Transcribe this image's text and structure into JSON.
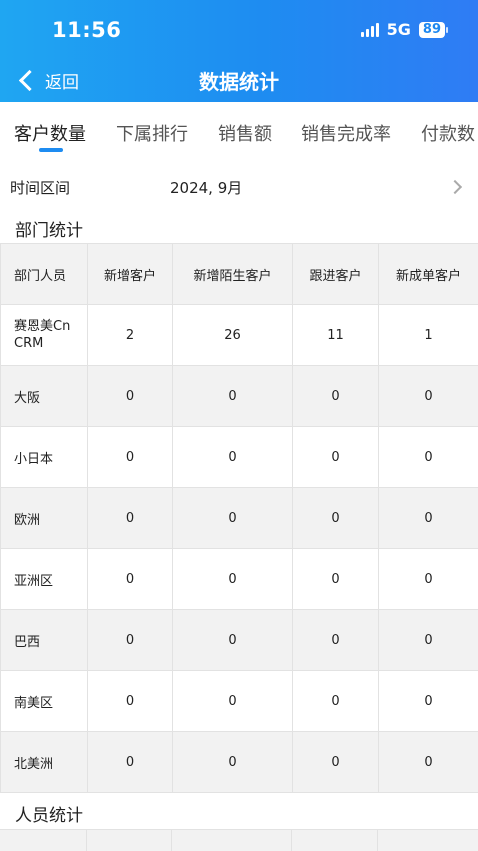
{
  "status": {
    "time": "11:56",
    "network": "5G",
    "battery": "89"
  },
  "nav": {
    "back_label": "返回",
    "title": "数据统计"
  },
  "tabs": [
    {
      "label": "客户数量",
      "active": true
    },
    {
      "label": "下属排行",
      "active": false
    },
    {
      "label": "销售额",
      "active": false
    },
    {
      "label": "销售完成率",
      "active": false
    },
    {
      "label": "付款数",
      "active": false
    }
  ],
  "time_range": {
    "label": "时间区间",
    "value": "2024, 9月"
  },
  "dept_section": {
    "title": "部门统计",
    "headers": [
      "部门人员",
      "新增客户",
      "新增陌生客户",
      "跟进客户",
      "新成单客户"
    ],
    "rows": [
      [
        "赛恩美Cn CRM",
        "2",
        "26",
        "11",
        "1"
      ],
      [
        "大阪",
        "0",
        "0",
        "0",
        "0"
      ],
      [
        "小日本",
        "0",
        "0",
        "0",
        "0"
      ],
      [
        "欧洲",
        "0",
        "0",
        "0",
        "0"
      ],
      [
        "亚洲区",
        "0",
        "0",
        "0",
        "0"
      ],
      [
        "巴西",
        "0",
        "0",
        "0",
        "0"
      ],
      [
        "南美区",
        "0",
        "0",
        "0",
        "0"
      ],
      [
        "北美洲",
        "0",
        "0",
        "0",
        "0"
      ]
    ]
  },
  "people_section": {
    "title": "人员统计"
  },
  "colors": {
    "accent": "#1e8cf1",
    "header_gradient_start": "#1fa6f2",
    "header_gradient_end": "#2f7cf4",
    "row_stripe": "#f2f2f2"
  }
}
